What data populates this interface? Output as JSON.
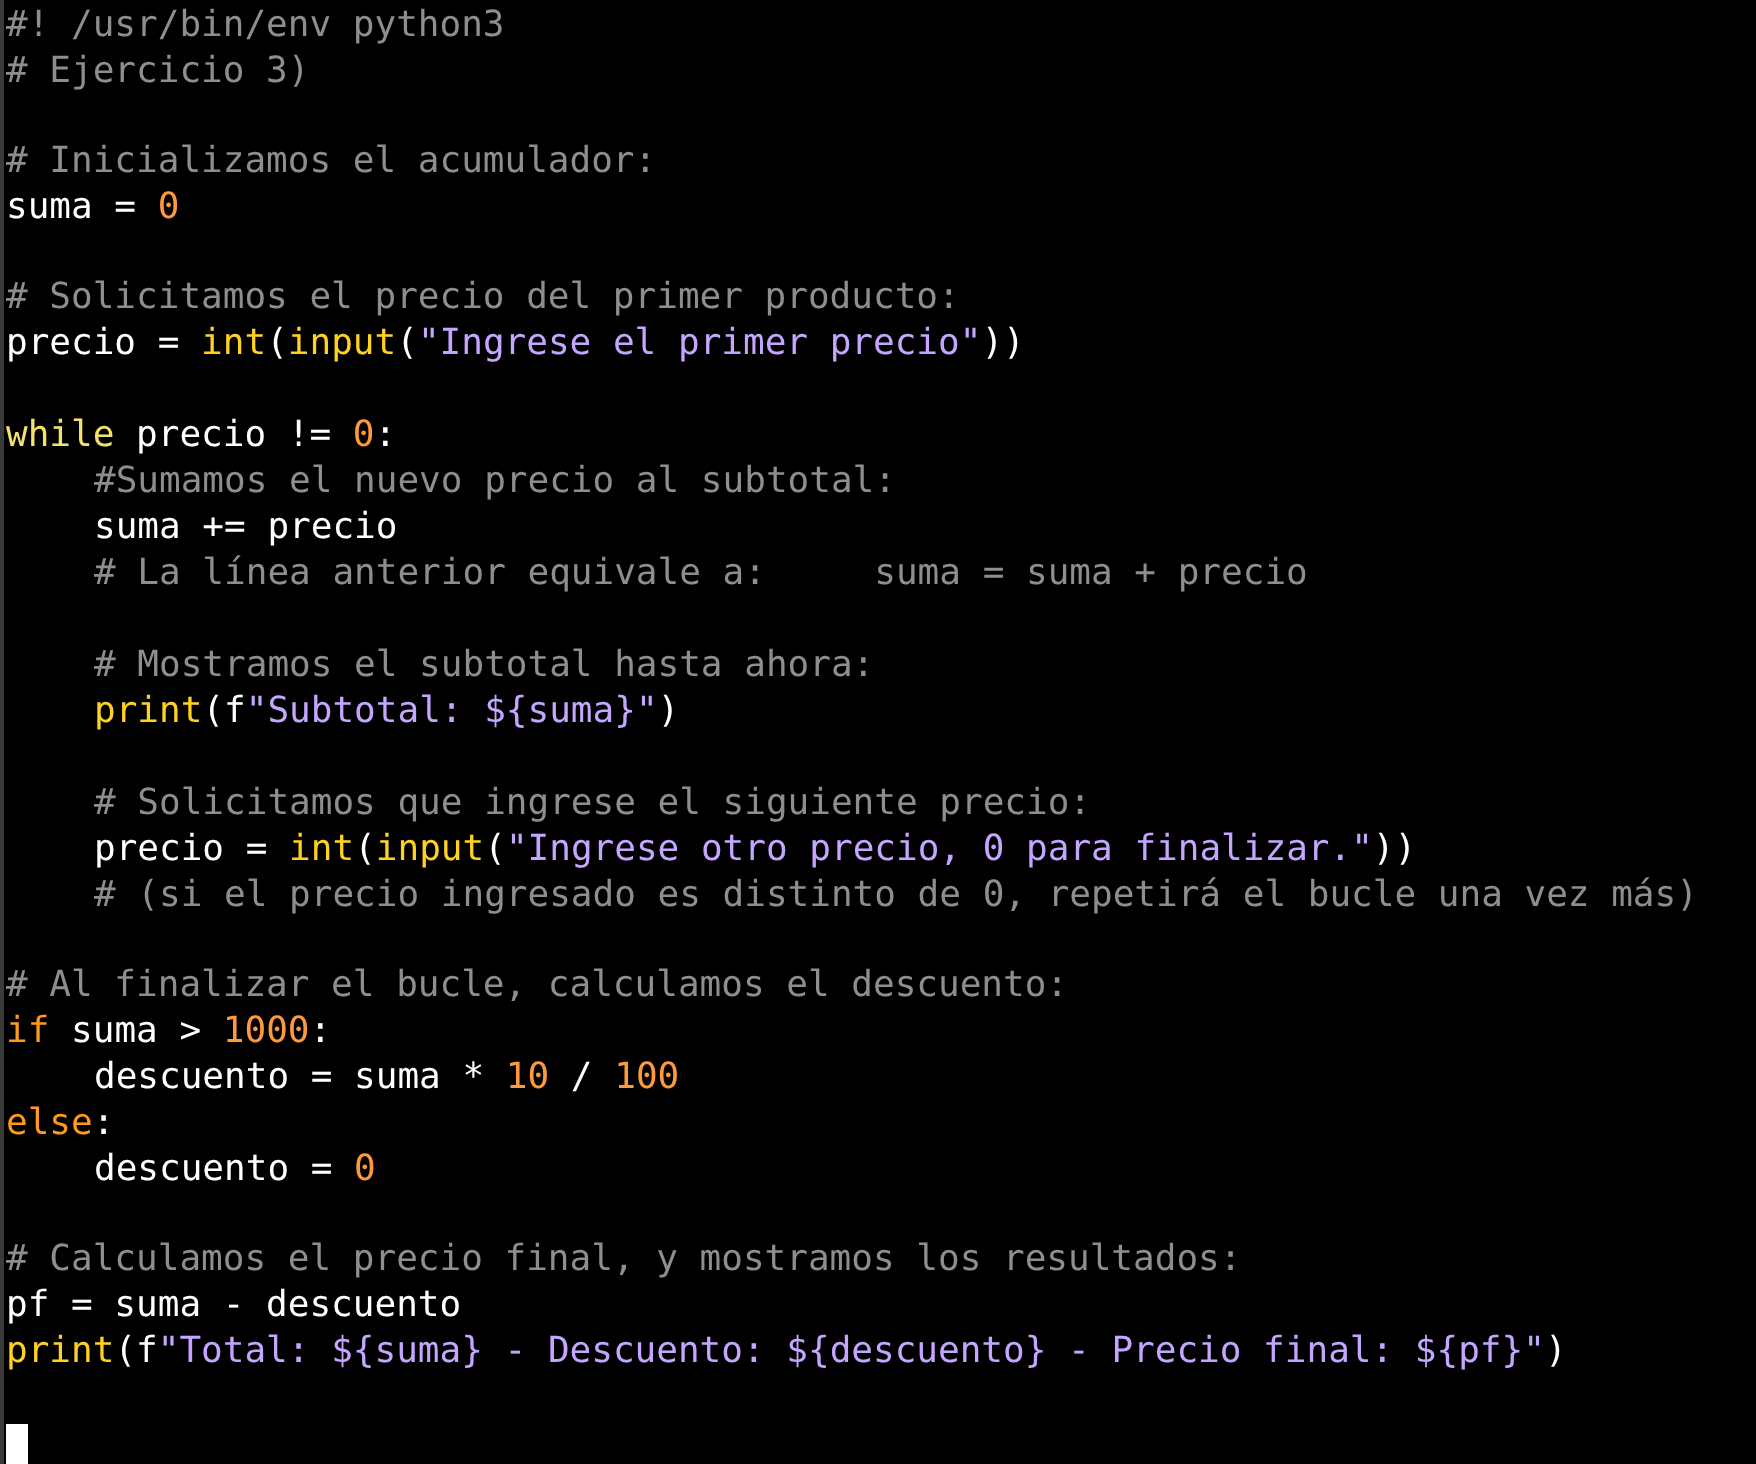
{
  "editor": {
    "lines": [
      {
        "kind": "code",
        "tokens": [
          {
            "kind": "comment",
            "text": "#! /usr/bin/env python3"
          }
        ]
      },
      {
        "kind": "code",
        "tokens": [
          {
            "kind": "comment",
            "text": "# Ejercicio 3)"
          }
        ]
      },
      {
        "kind": "blank"
      },
      {
        "kind": "code",
        "tokens": [
          {
            "kind": "comment",
            "text": "# Inicializamos el acumulador:"
          }
        ]
      },
      {
        "kind": "code",
        "tokens": [
          {
            "kind": "plain",
            "text": "suma = "
          },
          {
            "kind": "number",
            "text": "0"
          }
        ]
      },
      {
        "kind": "blank"
      },
      {
        "kind": "code",
        "tokens": [
          {
            "kind": "comment",
            "text": "# Solicitamos el precio del primer producto:"
          }
        ]
      },
      {
        "kind": "code",
        "tokens": [
          {
            "kind": "plain",
            "text": "precio = "
          },
          {
            "kind": "builtin",
            "text": "int"
          },
          {
            "kind": "plain",
            "text": "("
          },
          {
            "kind": "builtin",
            "text": "input"
          },
          {
            "kind": "plain",
            "text": "("
          },
          {
            "kind": "string",
            "text": "\"Ingrese el primer precio\""
          },
          {
            "kind": "plain",
            "text": "))"
          }
        ]
      },
      {
        "kind": "blank"
      },
      {
        "kind": "code",
        "tokens": [
          {
            "kind": "loop",
            "text": "while"
          },
          {
            "kind": "plain",
            "text": " precio != "
          },
          {
            "kind": "number",
            "text": "0"
          },
          {
            "kind": "plain",
            "text": ":"
          }
        ],
        "children": [
          {
            "kind": "code",
            "tokens": [
              {
                "kind": "comment",
                "text": "#Sumamos el nuevo precio al subtotal:"
              }
            ]
          },
          {
            "kind": "code",
            "tokens": [
              {
                "kind": "plain",
                "text": "suma += precio"
              }
            ]
          },
          {
            "kind": "code",
            "tokens": [
              {
                "kind": "comment",
                "text": "# La línea anterior equivale a:     suma = suma + precio"
              }
            ]
          },
          {
            "kind": "blank"
          },
          {
            "kind": "code",
            "tokens": [
              {
                "kind": "comment",
                "text": "# Mostramos el subtotal hasta ahora:"
              }
            ]
          },
          {
            "kind": "code",
            "tokens": [
              {
                "kind": "builtin",
                "text": "print"
              },
              {
                "kind": "plain",
                "text": "(f"
              },
              {
                "kind": "string",
                "text": "\"Subtotal: ${suma}\""
              },
              {
                "kind": "plain",
                "text": ")"
              }
            ]
          },
          {
            "kind": "blank"
          },
          {
            "kind": "code",
            "tokens": [
              {
                "kind": "comment",
                "text": "# Solicitamos que ingrese el siguiente precio:"
              }
            ]
          },
          {
            "kind": "code",
            "tokens": [
              {
                "kind": "plain",
                "text": "precio = "
              },
              {
                "kind": "builtin",
                "text": "int"
              },
              {
                "kind": "plain",
                "text": "("
              },
              {
                "kind": "builtin",
                "text": "input"
              },
              {
                "kind": "plain",
                "text": "("
              },
              {
                "kind": "string",
                "text": "\"Ingrese otro precio, 0 para finalizar.\""
              },
              {
                "kind": "plain",
                "text": "))"
              }
            ]
          },
          {
            "kind": "code",
            "tokens": [
              {
                "kind": "comment",
                "text": "# (si el precio ingresado es distinto de 0, repetirá el bucle una vez más)"
              }
            ]
          }
        ]
      },
      {
        "kind": "blank"
      },
      {
        "kind": "code",
        "tokens": [
          {
            "kind": "comment",
            "text": "# Al finalizar el bucle, calculamos el descuento:"
          }
        ]
      },
      {
        "kind": "code",
        "tokens": [
          {
            "kind": "keyword",
            "text": "if"
          },
          {
            "kind": "plain",
            "text": " suma > "
          },
          {
            "kind": "number",
            "text": "1000"
          },
          {
            "kind": "plain",
            "text": ":"
          }
        ],
        "children": [
          {
            "kind": "code",
            "tokens": [
              {
                "kind": "plain",
                "text": "descuento = suma * "
              },
              {
                "kind": "number",
                "text": "10"
              },
              {
                "kind": "plain",
                "text": " / "
              },
              {
                "kind": "number",
                "text": "100"
              }
            ]
          }
        ]
      },
      {
        "kind": "code",
        "tokens": [
          {
            "kind": "keyword",
            "text": "else"
          },
          {
            "kind": "plain",
            "text": ":"
          }
        ],
        "children": [
          {
            "kind": "code",
            "tokens": [
              {
                "kind": "plain",
                "text": "descuento = "
              },
              {
                "kind": "number",
                "text": "0"
              }
            ]
          }
        ]
      },
      {
        "kind": "blank"
      },
      {
        "kind": "code",
        "tokens": [
          {
            "kind": "comment",
            "text": "# Calculamos el precio final, y mostramos los resultados:"
          }
        ]
      },
      {
        "kind": "code",
        "tokens": [
          {
            "kind": "plain",
            "text": "pf = suma - descuento"
          }
        ]
      },
      {
        "kind": "code",
        "tokens": [
          {
            "kind": "builtin",
            "text": "print"
          },
          {
            "kind": "plain",
            "text": "(f"
          },
          {
            "kind": "string",
            "text": "\"Total: ${suma} - Descuento: ${descuento} - Precio final: ${pf}\""
          },
          {
            "kind": "plain",
            "text": ")"
          }
        ]
      },
      {
        "kind": "blank"
      },
      {
        "kind": "cursor"
      }
    ]
  }
}
